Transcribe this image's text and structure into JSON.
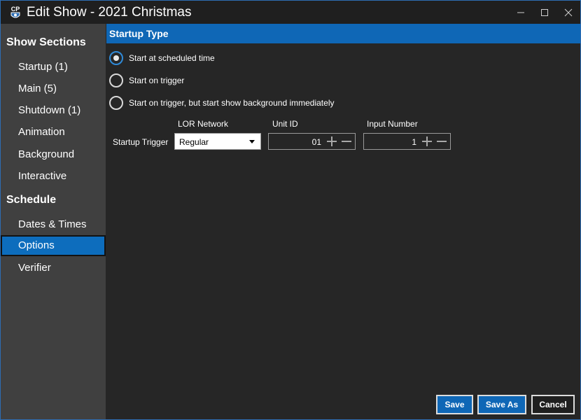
{
  "window": {
    "title": "Edit Show - 2021 Christmas",
    "icon_text": "CP"
  },
  "sidebar": {
    "sections_heading": "Show Sections",
    "section_items": [
      {
        "label": "Startup (1)"
      },
      {
        "label": "Main (5)"
      },
      {
        "label": "Shutdown (1)"
      },
      {
        "label": "Animation"
      },
      {
        "label": "Background"
      },
      {
        "label": "Interactive"
      }
    ],
    "schedule_heading": "Schedule",
    "schedule_items": [
      {
        "label": "Dates & Times"
      },
      {
        "label": "Options",
        "selected": true
      },
      {
        "label": "Verifier"
      }
    ]
  },
  "main": {
    "section_title": "Startup Type",
    "options": [
      {
        "label": "Start at scheduled time",
        "checked": true
      },
      {
        "label": "Start on trigger",
        "checked": false
      },
      {
        "label": "Start on trigger, but start show background immediately",
        "checked": false
      }
    ],
    "trigger": {
      "row_label": "Startup Trigger",
      "network_label": "LOR Network",
      "network_value": "Regular",
      "unit_label": "Unit ID",
      "unit_value": "01",
      "input_label": "Input Number",
      "input_value": "1"
    }
  },
  "buttons": {
    "save": "Save",
    "save_as": "Save As",
    "cancel": "Cancel"
  },
  "colors": {
    "accent": "#0f67b6",
    "sidebar_bg": "#404040",
    "panel_bg": "#262626",
    "titlebar_bg": "#1f1f1f"
  }
}
